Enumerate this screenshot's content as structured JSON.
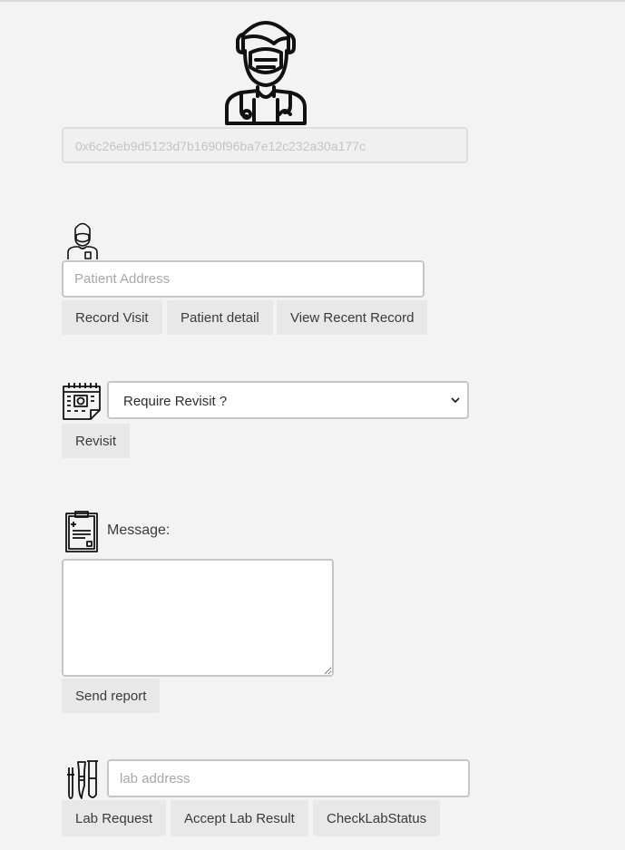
{
  "account_address": "0x6c26eb9d5123d7b1690f96ba7e12c232a30a177c",
  "patient": {
    "address_placeholder": "Patient Address",
    "buttons": {
      "record_visit": "Record Visit",
      "patient_detail": "Patient detail",
      "view_recent_record": "View Recent Record"
    }
  },
  "revisit": {
    "select_value": "Require Revisit ?",
    "button": "Revisit"
  },
  "report": {
    "message_label": "Message:",
    "button": "Send report"
  },
  "lab": {
    "address_placeholder": "lab address",
    "buttons": {
      "lab_request": "Lab Request",
      "accept_lab_result": "Accept Lab Result",
      "check_lab_status": "CheckLabStatus"
    }
  },
  "icons": {
    "header": "doctor-icon",
    "patient": "patient-icon",
    "revisit": "calendar-icon",
    "report": "clipboard-icon",
    "lab": "lab-tools-icon"
  },
  "colors": {
    "background": "#f3f3f3",
    "button": "#e8e8e8",
    "input_border": "#c6c6c6"
  }
}
